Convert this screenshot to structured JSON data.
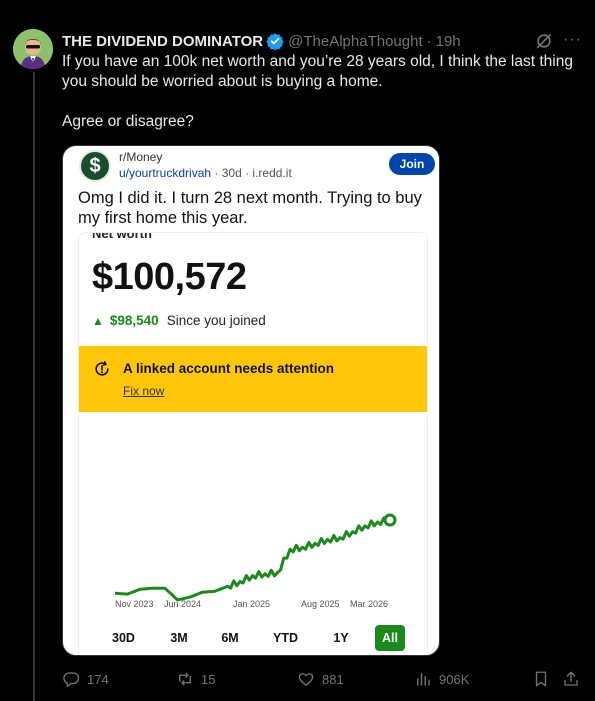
{
  "tweet": {
    "author_name": "THE DIVIDEND DOMINATOR",
    "handle": "@TheAlphaThought",
    "separator": "·",
    "time": "19h",
    "line1": "If you have an 100k net worth and you’re 28 years old, I think the last thing",
    "line2": "you should be worried about is buying a home.",
    "line3": "Agree or disagree?",
    "more_label": "···"
  },
  "reddit": {
    "subreddit": "r/Money",
    "user": "u/yourtruckdrivah",
    "age": "· 30d ·",
    "domain": "i.redd.it",
    "join_label": "Join",
    "avatar_glyph": "$",
    "title": "Omg I did it. I turn 28 next month. Trying to buy my first home this year."
  },
  "app": {
    "label": "Net worth",
    "value": "$100,572",
    "change_arrow": "▲",
    "change_amount": "$98,540",
    "change_text": "Since you joined",
    "banner_text": "A linked account needs attention",
    "banner_link": "Fix now",
    "ranges": [
      "30D",
      "3M",
      "6M",
      "YTD",
      "1Y",
      "All"
    ],
    "active_range": "All"
  },
  "chart_data": {
    "type": "line",
    "x_tick_labels": [
      "Nov 2023",
      "Jun 2024",
      "Jan 2025",
      "Aug 2025",
      "Mar 2026"
    ],
    "series": [
      {
        "values": [
          7,
          6,
          11,
          12,
          12,
          0,
          3,
          8,
          9,
          14,
          19,
          25,
          27,
          28,
          52,
          54,
          58,
          62,
          64,
          70,
          76,
          80,
          82
        ],
        "color": "#1a8a1a"
      }
    ],
    "y_axis_labels": "none",
    "grid": false
  },
  "engagement": {
    "replies": "174",
    "reposts": "15",
    "likes": "881",
    "views": "906K"
  },
  "colors": {
    "accent_blue": "#1d9bf0",
    "reddit_join": "#0045ac",
    "banner": "#ffc60a",
    "chart_green": "#1a8a1a"
  },
  "icons": [
    "verified-badge-icon",
    "grok-icon",
    "more-icon",
    "attention-icon",
    "reply-icon",
    "repost-icon",
    "like-icon",
    "views-icon",
    "bookmark-icon",
    "share-icon"
  ]
}
